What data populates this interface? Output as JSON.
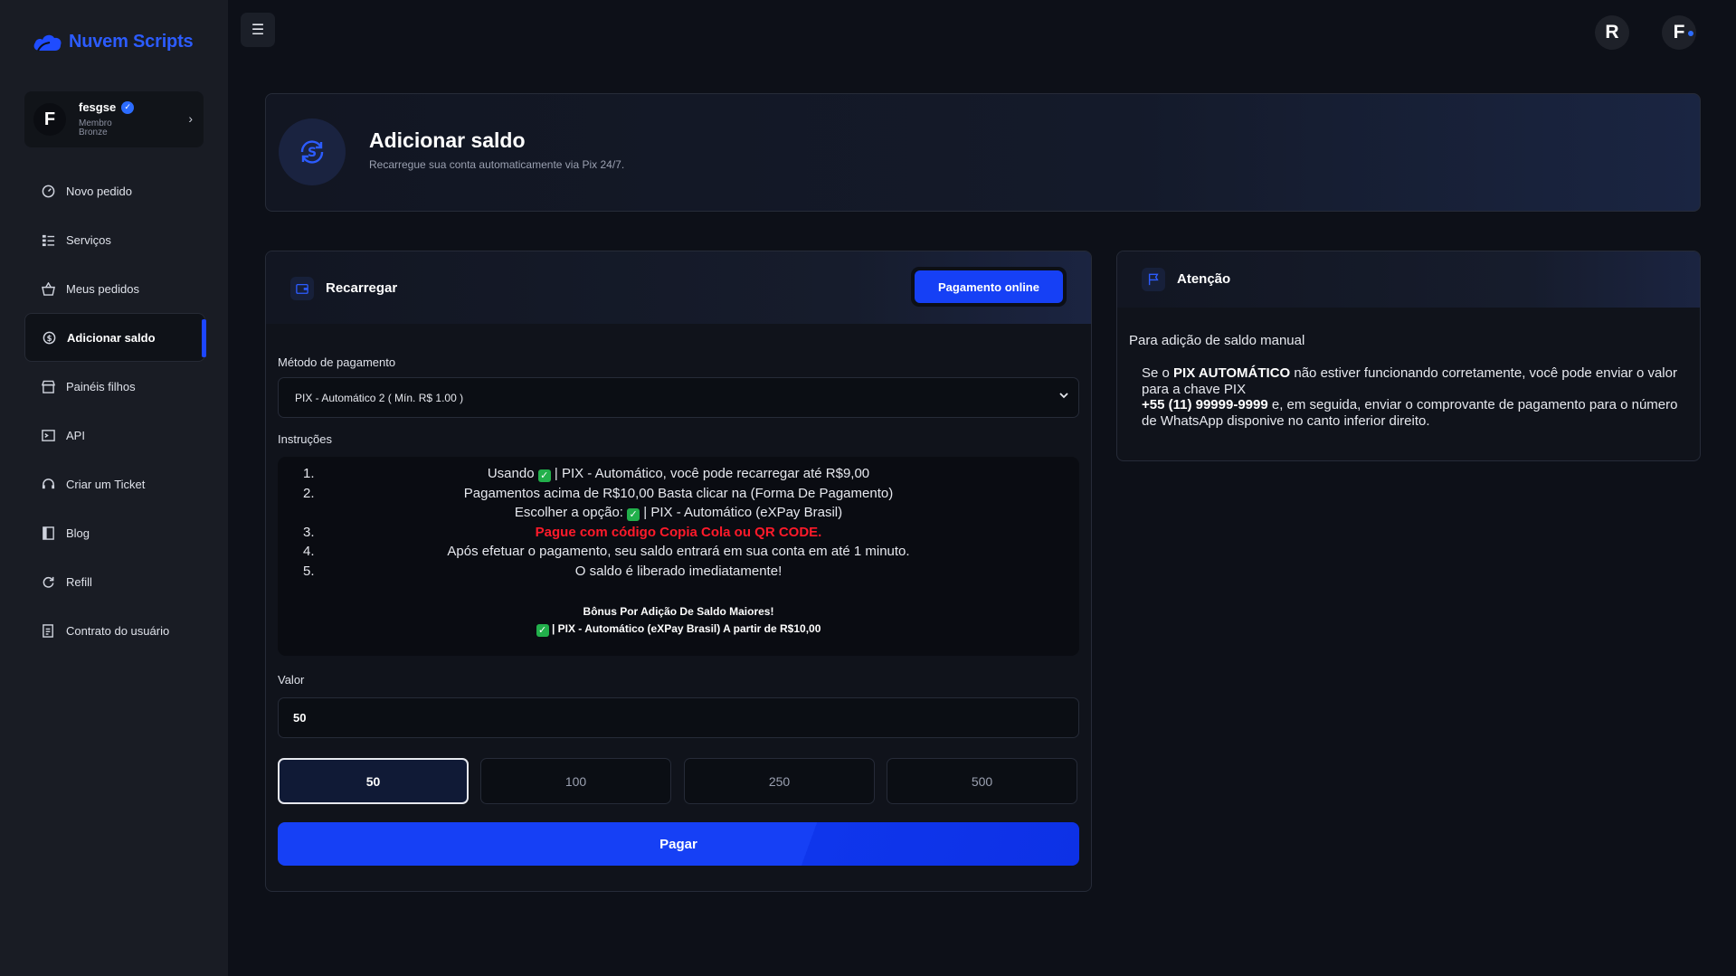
{
  "brand": {
    "name": "Nuvem Scripts",
    "color": "#2c5cff"
  },
  "user": {
    "initial": "F",
    "name": "fesgse",
    "rank": "Membro Bronze"
  },
  "sidebar": {
    "items": [
      {
        "label": "Novo pedido",
        "icon": "gauge-icon"
      },
      {
        "label": "Serviços",
        "icon": "list-icon"
      },
      {
        "label": "Meus pedidos",
        "icon": "basket-icon"
      },
      {
        "label": "Adicionar saldo",
        "icon": "coin-icon",
        "active": true
      },
      {
        "label": "Painéis filhos",
        "icon": "store-icon"
      },
      {
        "label": "API",
        "icon": "terminal-icon"
      },
      {
        "label": "Criar um Ticket",
        "icon": "headset-icon"
      },
      {
        "label": "Blog",
        "icon": "book-icon"
      },
      {
        "label": "Refill",
        "icon": "refresh-icon"
      },
      {
        "label": "Contrato do usuário",
        "icon": "document-icon"
      }
    ]
  },
  "topbar": {
    "avatar_r": "R",
    "avatar_f": "F"
  },
  "header": {
    "title": "Adicionar saldo",
    "subtitle": "Recarregue sua conta automaticamente via Pix 24/7."
  },
  "recharge": {
    "title": "Recarregar",
    "online_button": "Pagamento online",
    "method_label": "Método de pagamento",
    "method_value": "PIX - Automático 2 ( Mín. R$ 1.00 )",
    "instructions_label": "Instruções",
    "instructions": [
      {
        "num": "1.",
        "pre": "Usando",
        "text": "| PIX - Automático, você pode recarregar até R$9,00"
      },
      {
        "num": "2.",
        "text": "Pagamentos acima de R$10,00 Basta clicar na (Forma De Pagamento)"
      },
      {
        "num": "",
        "pre": "Escolher a opção:",
        "text": "| PIX - Automático (eXPay Brasil)"
      },
      {
        "num": "3.",
        "text": "Pague com código Copia Cola ou QR CODE."
      },
      {
        "num": "4.",
        "text": "Após efetuar o pagamento, seu saldo entrará em sua conta em até 1 minuto."
      },
      {
        "num": "5.",
        "text": "O saldo é liberado imediatamente!"
      }
    ],
    "bonus_title": "Bônus Por Adição De Saldo Maiores!",
    "bonus_line": "| PIX - Automático (eXPay Brasil) A partir de R$10,00",
    "value_label": "Valor",
    "value": "50",
    "amounts": [
      "50",
      "100",
      "250",
      "500"
    ],
    "selected_amount": "50",
    "pay_button": "Pagar"
  },
  "attention": {
    "title": "Atenção",
    "intro": "Para adição de saldo manual",
    "p1_pre": "Se o",
    "p1_bold": "PIX AUTOMÁTICO",
    "p1_post": "não estiver funcionando corretamente, você pode enviar o valor para a chave PIX",
    "phone": "+55 (11) 99999-9999",
    "p2": "e, em seguida, enviar o comprovante de pagamento para o número de WhatsApp disponive no canto inferior direito."
  },
  "colors": {
    "accent": "#1640f5",
    "danger": "#ff1a2a",
    "success": "#22b04b"
  }
}
